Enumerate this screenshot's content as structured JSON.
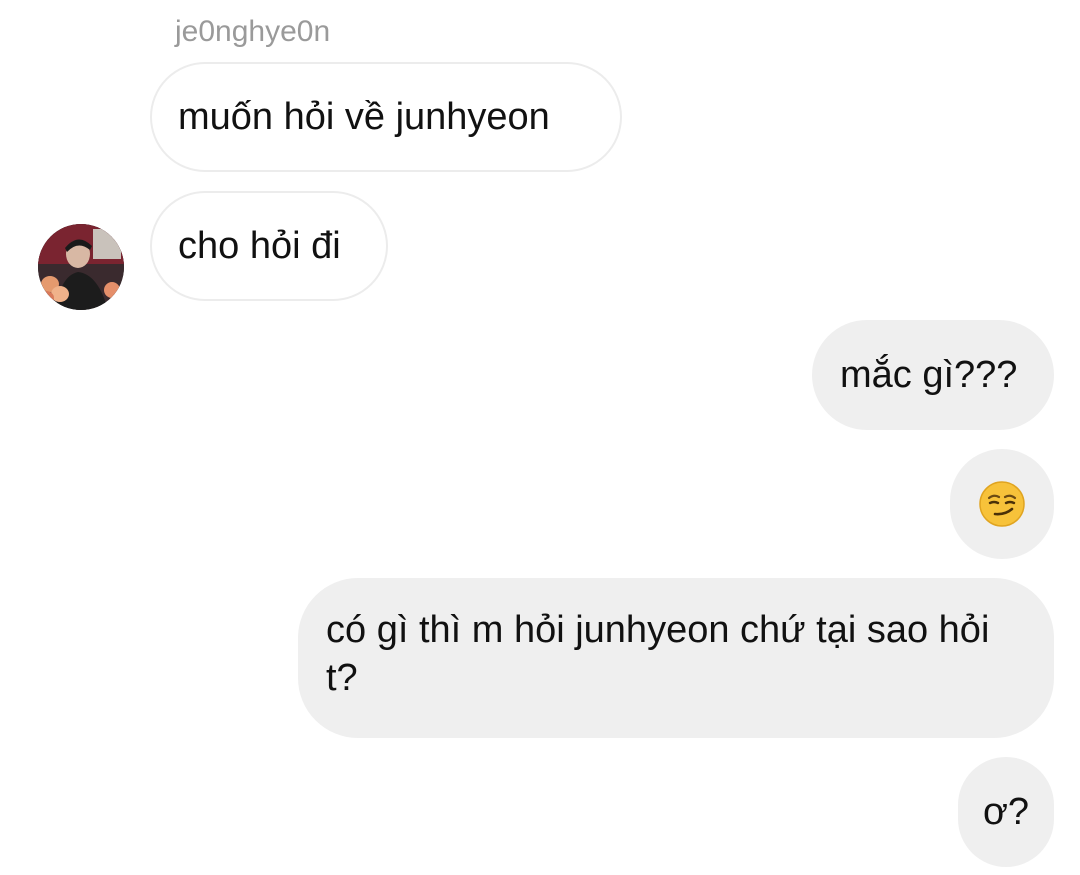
{
  "thread": {
    "sender_username": "je0nghye0n",
    "messages": [
      {
        "side": "incoming",
        "text": "muốn hỏi về junhyeon"
      },
      {
        "side": "incoming",
        "text": "cho hỏi đi"
      },
      {
        "side": "outgoing",
        "text": "mắc gì???"
      },
      {
        "side": "outgoing",
        "emoji": "smirking-face-emoji"
      },
      {
        "side": "outgoing",
        "text": "có gì thì m hỏi junhyeon chứ tại sao hỏi t?"
      },
      {
        "side": "outgoing",
        "text": "ơ?"
      }
    ]
  },
  "colors": {
    "incoming_bubble_bg": "#ffffff",
    "incoming_bubble_border": "#ececec",
    "outgoing_bubble_bg": "#efefef",
    "username_text": "#9a9a9a",
    "message_text": "#111111"
  }
}
